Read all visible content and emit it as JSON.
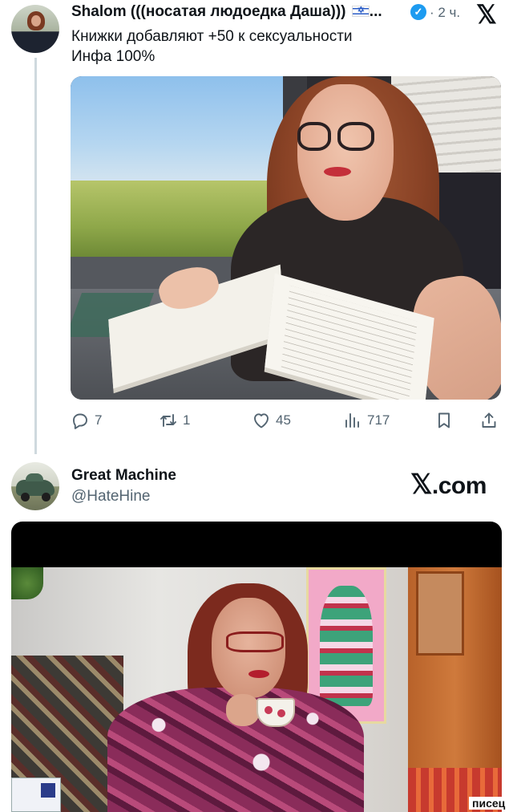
{
  "tweet1": {
    "author_name": "Shalom (((носатая людоедка Даша)))",
    "name_suffix": "...",
    "flag_icon": "israel-flag-icon",
    "verified_icon": "verified-badge-icon",
    "time": "· 2 ч.",
    "platform_logo": "𝕏",
    "text_lines": [
      "Книжки добавляют +50 к сексуальности",
      "Инфа 100%"
    ],
    "actions": {
      "replies": "7",
      "retweets": "1",
      "likes": "45",
      "views": "717"
    }
  },
  "tweet2": {
    "author_name": "Great Machine",
    "handle": "@HateHine",
    "site_brand_x": "𝕏",
    "site_brand_rest": ".com"
  },
  "watermark": "писец",
  "colors": {
    "text_primary": "#0f1419",
    "text_secondary": "#536471",
    "verified": "#1d9bf0",
    "thread_line": "#cfd9de"
  }
}
